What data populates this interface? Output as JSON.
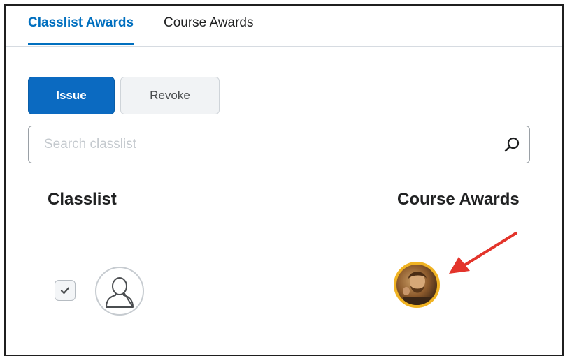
{
  "tabs": [
    {
      "label": "Classlist Awards",
      "active": true
    },
    {
      "label": "Course Awards",
      "active": false
    }
  ],
  "actions": {
    "issue_label": "Issue",
    "revoke_label": "Revoke"
  },
  "search": {
    "placeholder": "Search classlist",
    "value": "",
    "icon": "search-icon"
  },
  "table": {
    "columns": [
      "Classlist",
      "Course Awards"
    ],
    "rows": [
      {
        "checked": true,
        "avatar": "default-user-avatar",
        "award": "award-badge"
      }
    ]
  },
  "colors": {
    "accent": "#006fbf",
    "badge_ring": "#f0b323",
    "annotation_arrow": "#e3342b"
  }
}
